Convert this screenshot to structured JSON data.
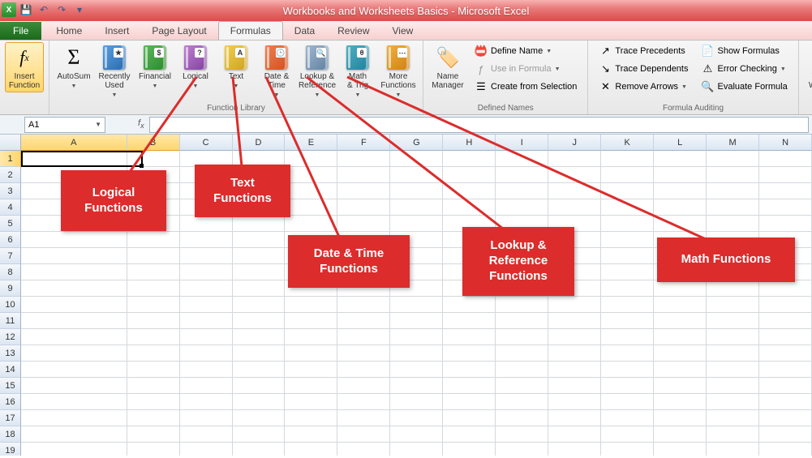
{
  "title": "Workbooks and Worksheets Basics - Microsoft Excel",
  "tabs": {
    "file": "File",
    "items": [
      "Home",
      "Insert",
      "Page Layout",
      "Formulas",
      "Data",
      "Review",
      "View"
    ],
    "active": "Formulas"
  },
  "ribbon": {
    "insert_function": "Insert\nFunction",
    "library": {
      "label": "Function Library",
      "autosum": "AutoSum",
      "recently": "Recently\nUsed",
      "financial": "Financial",
      "logical": "Logical",
      "text": "Text",
      "date_time": "Date &\nTime",
      "lookup": "Lookup &\nReference",
      "math": "Math\n& Trig",
      "more": "More\nFunctions"
    },
    "names": {
      "label": "Defined Names",
      "manager": "Name\nManager",
      "define": "Define Name",
      "use": "Use in Formula",
      "create": "Create from Selection"
    },
    "audit": {
      "label": "Formula Auditing",
      "trace_prec": "Trace Precedents",
      "trace_dep": "Trace Dependents",
      "remove": "Remove Arrows",
      "show": "Show Formulas",
      "error": "Error Checking",
      "eval": "Evaluate Formula"
    },
    "watch": "Watch\nWindow"
  },
  "namebox": "A1",
  "columns": [
    "A",
    "B",
    "C",
    "D",
    "E",
    "F",
    "G",
    "H",
    "I",
    "J",
    "K",
    "L",
    "M",
    "N"
  ],
  "rows": 19,
  "callouts": {
    "logical": "Logical\nFunctions",
    "text": "Text\nFunctions",
    "date": "Date & Time\nFunctions",
    "lookup": "Lookup &\nReference\nFunctions",
    "math": "Math Functions"
  }
}
